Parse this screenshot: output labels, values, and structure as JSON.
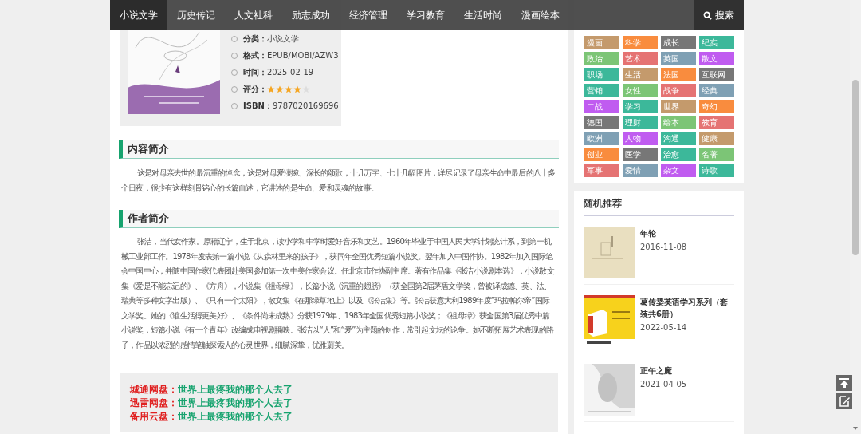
{
  "nav": {
    "items": [
      {
        "label": "小说文学",
        "selected": true
      },
      {
        "label": "历史传记",
        "selected": false
      },
      {
        "label": "人文社科",
        "selected": false
      },
      {
        "label": "励志成功",
        "selected": false
      },
      {
        "label": "经济管理",
        "selected": false
      },
      {
        "label": "学习教育",
        "selected": false
      },
      {
        "label": "生活时尚",
        "selected": false
      },
      {
        "label": "漫画绘本",
        "selected": false
      }
    ],
    "search": "搜索"
  },
  "book": {
    "info": [
      {
        "label": "分类：",
        "value": "小说文学"
      },
      {
        "label": "格式：",
        "value": "EPUB/MOBI/AZW3"
      },
      {
        "label": "时间：",
        "value": "2025-02-19"
      },
      {
        "label": "评分：",
        "stars": 4
      },
      {
        "label": "ISBN：",
        "value": "9787020169696"
      }
    ]
  },
  "sections": [
    {
      "title": "内容简介",
      "text": "这是对母亲去世的最沉重的悼念；这是对母爱凄婉、深长的颂歌；十几万字、七十几幅图片，详尽记录了母亲生命中最后的八十多个日夜；很少有这样刻骨铭心的长篇自述；它讲述的是生命、爱和灵魂的故事。"
    },
    {
      "title": "作者简介",
      "text": "张洁，当代女作家。原籍辽宁，生于北京，读小学和中学时爱好音乐和文艺。1960年毕业于中国人民大学计划统计系，到第一机械工业部工作。1978年发表第一篇小说《从森林里来的孩子》，获同年全国优秀短篇小说奖。翌年加入中国作协。1982年加入国际笔会中国中心，并随中国作家代表团赴美国参加第一次中美作家会议。任北京市作协副主席。著有作品集《张洁小说剧本选》，小说散文集《爱是不能忘记的》、《方舟》，小说集《祖母绿》，长篇小说《沉重的翅膀》（获全国第2届茅盾文学奖，曾被译成德、英、法、瑞典等多种文字出版）、《只有一个太阳》，散文集《在那绿草地上》以及《张洁集》等。张洁获意大利1989年度“玛拉帕尔帝”国际文学奖。她的《谁生活得更美好》、《条件尚未成熟》分获1979年、1983年全国优秀短篇小说奖；《祖母绿》获全国第3届优秀中篇小说奖，短篇小说《有一个青年》改编成电视剧播映。张洁以“人”和“爱”为主题的创作，常引起文坛的论争。她不断拓展艺术表现的路子，作品以浓烈的感情笔触探索人的心灵世界，细腻深挚，优雅蔚美。"
    }
  ],
  "downloads": [
    {
      "label": "城通网盘：",
      "title": "世界上最疼我的那个人去了"
    },
    {
      "label": "迅雷网盘：",
      "title": "世界上最疼我的那个人去了"
    },
    {
      "label": "备用云盘：",
      "title": "世界上最疼我的那个人去了"
    }
  ],
  "tags": [
    {
      "label": "漫画",
      "color": "#c49a6c"
    },
    {
      "label": "科学",
      "color": "#f98c3e"
    },
    {
      "label": "成长",
      "color": "#777777"
    },
    {
      "label": "纪实",
      "color": "#3cb89a"
    },
    {
      "label": "政治",
      "color": "#7cc576"
    },
    {
      "label": "艺术",
      "color": "#e57373"
    },
    {
      "label": "英国",
      "color": "#7fa0b4"
    },
    {
      "label": "散文",
      "color": "#c05cf0"
    },
    {
      "label": "职场",
      "color": "#3cb89a"
    },
    {
      "label": "生活",
      "color": "#c49a6c"
    },
    {
      "label": "法国",
      "color": "#f98c3e"
    },
    {
      "label": "互联网",
      "color": "#777777"
    },
    {
      "label": "营销",
      "color": "#3cb89a"
    },
    {
      "label": "女性",
      "color": "#7cc576"
    },
    {
      "label": "战争",
      "color": "#e57373"
    },
    {
      "label": "经典",
      "color": "#7fa0b4"
    },
    {
      "label": "二战",
      "color": "#c05cf0"
    },
    {
      "label": "学习",
      "color": "#3cb89a"
    },
    {
      "label": "世界",
      "color": "#c49a6c"
    },
    {
      "label": "奇幻",
      "color": "#f98c3e"
    },
    {
      "label": "德国",
      "color": "#777777"
    },
    {
      "label": "理财",
      "color": "#3cb89a"
    },
    {
      "label": "绘本",
      "color": "#7cc576"
    },
    {
      "label": "教育",
      "color": "#e57373"
    },
    {
      "label": "欧洲",
      "color": "#7fa0b4"
    },
    {
      "label": "人物",
      "color": "#c05cf0"
    },
    {
      "label": "沟通",
      "color": "#3cb89a"
    },
    {
      "label": "健康",
      "color": "#c49a6c"
    },
    {
      "label": "创业",
      "color": "#f98c3e"
    },
    {
      "label": "医学",
      "color": "#777777"
    },
    {
      "label": "治愈",
      "color": "#3cb89a"
    },
    {
      "label": "名著",
      "color": "#7cc576"
    },
    {
      "label": "军事",
      "color": "#e57373"
    },
    {
      "label": "爱情",
      "color": "#7fa0b4"
    },
    {
      "label": "杂文",
      "color": "#c05cf0"
    },
    {
      "label": "诗歌",
      "color": "#3cb89a"
    }
  ],
  "random": {
    "title": "随机推荐",
    "items": [
      {
        "title": "年轮",
        "date": "2016-11-08"
      },
      {
        "title": "葛传椝英语学习系列（套装共6册）",
        "date": "2022-05-14"
      },
      {
        "title": "正午之魔",
        "date": "2021-04-05"
      }
    ]
  }
}
